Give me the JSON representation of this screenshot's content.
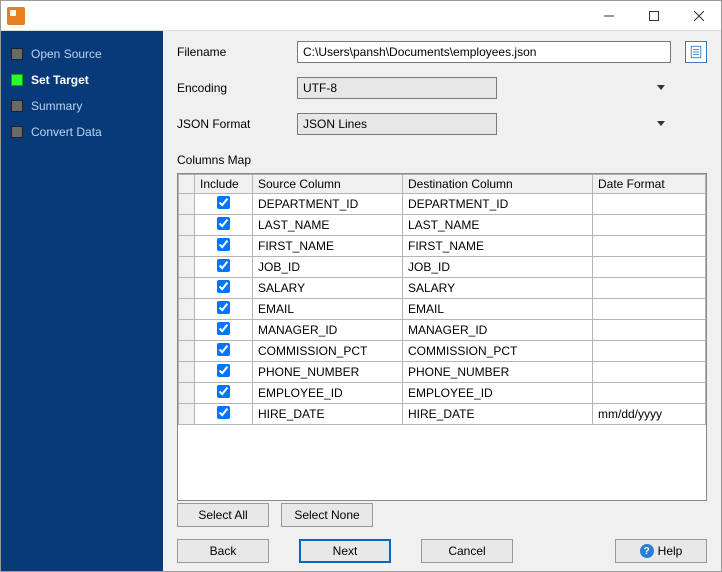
{
  "sidebar": {
    "steps": [
      {
        "label": "Open Source",
        "active": false
      },
      {
        "label": "Set Target",
        "active": true
      },
      {
        "label": "Summary",
        "active": false
      },
      {
        "label": "Convert Data",
        "active": false
      }
    ]
  },
  "form": {
    "filename_label": "Filename",
    "filename_value": "C:\\Users\\pansh\\Documents\\employees.json",
    "encoding_label": "Encoding",
    "encoding_value": "UTF-8",
    "jsonformat_label": "JSON Format",
    "jsonformat_value": "JSON Lines"
  },
  "columns_map": {
    "title": "Columns Map",
    "headers": {
      "include": "Include",
      "source": "Source Column",
      "destination": "Destination Column",
      "dateformat": "Date Format"
    },
    "rows": [
      {
        "include": true,
        "source": "DEPARTMENT_ID",
        "destination": "DEPARTMENT_ID",
        "dateformat": ""
      },
      {
        "include": true,
        "source": "LAST_NAME",
        "destination": "LAST_NAME",
        "dateformat": ""
      },
      {
        "include": true,
        "source": "FIRST_NAME",
        "destination": "FIRST_NAME",
        "dateformat": ""
      },
      {
        "include": true,
        "source": "JOB_ID",
        "destination": "JOB_ID",
        "dateformat": ""
      },
      {
        "include": true,
        "source": "SALARY",
        "destination": "SALARY",
        "dateformat": ""
      },
      {
        "include": true,
        "source": "EMAIL",
        "destination": "EMAIL",
        "dateformat": ""
      },
      {
        "include": true,
        "source": "MANAGER_ID",
        "destination": "MANAGER_ID",
        "dateformat": ""
      },
      {
        "include": true,
        "source": "COMMISSION_PCT",
        "destination": "COMMISSION_PCT",
        "dateformat": ""
      },
      {
        "include": true,
        "source": "PHONE_NUMBER",
        "destination": "PHONE_NUMBER",
        "dateformat": ""
      },
      {
        "include": true,
        "source": "EMPLOYEE_ID",
        "destination": "EMPLOYEE_ID",
        "dateformat": ""
      },
      {
        "include": true,
        "source": "HIRE_DATE",
        "destination": "HIRE_DATE",
        "dateformat": "mm/dd/yyyy"
      }
    ],
    "select_all": "Select All",
    "select_none": "Select None"
  },
  "footer": {
    "back": "Back",
    "next": "Next",
    "cancel": "Cancel",
    "help": "Help"
  }
}
